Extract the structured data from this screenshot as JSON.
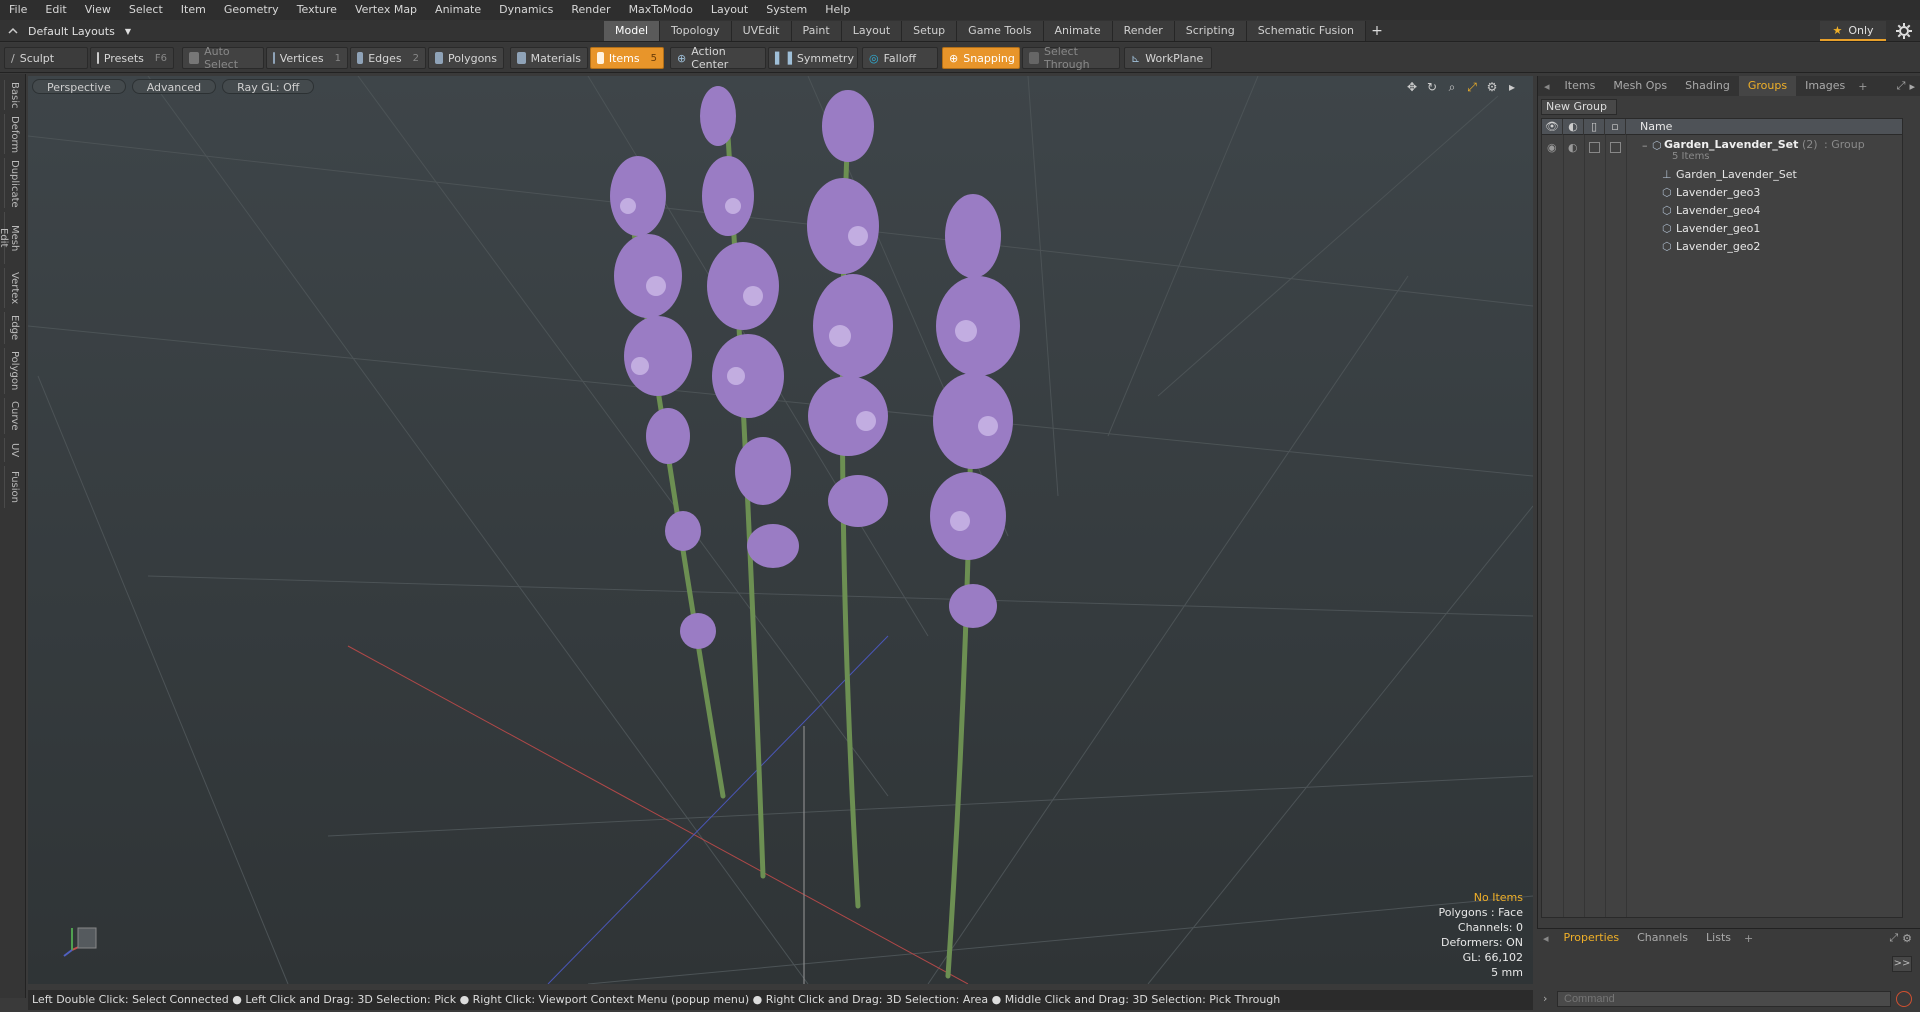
{
  "menu": [
    "File",
    "Edit",
    "View",
    "Select",
    "Item",
    "Geometry",
    "Texture",
    "Vertex Map",
    "Animate",
    "Dynamics",
    "Render",
    "MaxToModo",
    "Layout",
    "System",
    "Help"
  ],
  "layout": {
    "selector": "Default Layouts"
  },
  "tabs": [
    "Model",
    "Topology",
    "UVEdit",
    "Paint",
    "Layout",
    "Setup",
    "Game Tools",
    "Animate",
    "Render",
    "Scripting",
    "Schematic Fusion"
  ],
  "only_label": "Only",
  "toolbar": {
    "sculpt": "Sculpt",
    "presets": "Presets",
    "presets_key": "F6",
    "auto_select": "Auto Select",
    "vertices": "Vertices",
    "vertices_num": "1",
    "edges": "Edges",
    "edges_num": "2",
    "polygons": "Polygons",
    "materials": "Materials",
    "items": "Items",
    "items_num": "5",
    "action_center": "Action Center",
    "symmetry": "Symmetry",
    "falloff": "Falloff",
    "snapping": "Snapping",
    "select_through": "Select Through",
    "workplane": "WorkPlane"
  },
  "left_tabs": [
    "Basic",
    "Deform",
    "Duplicate",
    "Mesh Edit",
    "Vertex",
    "Edge",
    "Polygon",
    "Curve",
    "UV",
    "Fusion"
  ],
  "viewport": {
    "view": "Perspective",
    "advanced": "Advanced",
    "raygl": "Ray GL: Off",
    "info": {
      "no_items": "No Items",
      "polygons": "Polygons : Face",
      "channels": "Channels: 0",
      "deformers": "Deformers: ON",
      "gl": "GL: 66,102",
      "scale": "5 mm"
    }
  },
  "status": "Left Double Click: Select Connected ● Left Click and Drag: 3D Selection: Pick ● Right Click: Viewport Context Menu (popup menu) ● Right Click and Drag: 3D Selection: Area ● Middle Click and Drag: 3D Selection: Pick Through",
  "right_panel": {
    "tabs": [
      "Items",
      "Mesh Ops",
      "Shading",
      "Groups",
      "Images"
    ],
    "active_tab": "Groups",
    "new_group": "New Group",
    "name_header": "Name",
    "group": {
      "name": "Garden_Lavender_Set",
      "count": "(2)",
      "type": ": Group",
      "items": "5 Items"
    },
    "children": [
      "Garden_Lavender_Set",
      "Lavender_geo3",
      "Lavender_geo4",
      "Lavender_geo1",
      "Lavender_geo2"
    ]
  },
  "bottom_panel": {
    "tabs": [
      "Properties",
      "Channels",
      "Lists"
    ],
    "command_placeholder": "Command",
    "arrows": ">>"
  },
  "colors": {
    "accent": "#e8952a",
    "active_text": "#f0b028",
    "flower": "#9a7cc4",
    "stem": "#6c8f52"
  }
}
